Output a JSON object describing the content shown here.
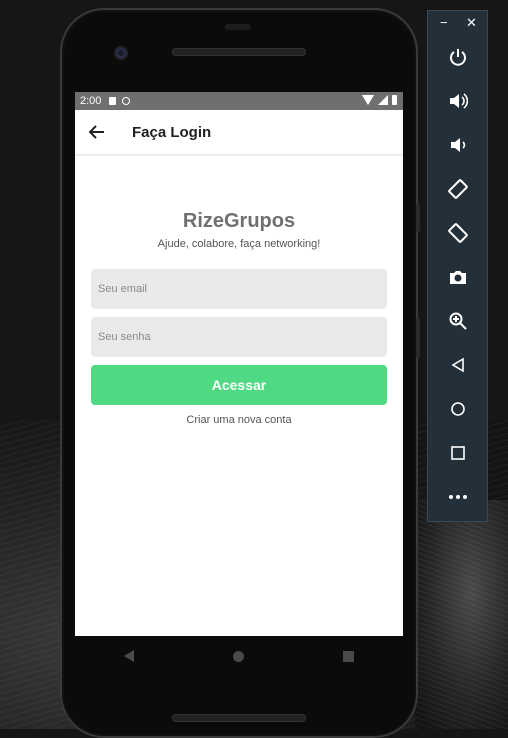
{
  "status_bar": {
    "time": "2:00"
  },
  "app_bar": {
    "title": "Faça Login"
  },
  "login": {
    "brand": "RizeGrupos",
    "tagline": "Ajude, colabore, faça networking!",
    "email_placeholder": "Seu email",
    "password_placeholder": "Seu senha",
    "submit_label": "Acessar",
    "create_account_link": "Criar uma nova conta"
  },
  "colors": {
    "accent": "#4fd983",
    "status_bar": "#6f6f6f",
    "brand_text": "#707070",
    "panel_bg": "#243039"
  },
  "emulator_panel": {
    "window_controls": [
      "−",
      "✕"
    ],
    "controls": [
      "power-icon",
      "volume-up-icon",
      "volume-down-icon",
      "rotate-left-icon",
      "rotate-right-icon",
      "camera-icon",
      "zoom-icon",
      "back-icon",
      "home-icon",
      "overview-icon",
      "more-icon"
    ]
  }
}
